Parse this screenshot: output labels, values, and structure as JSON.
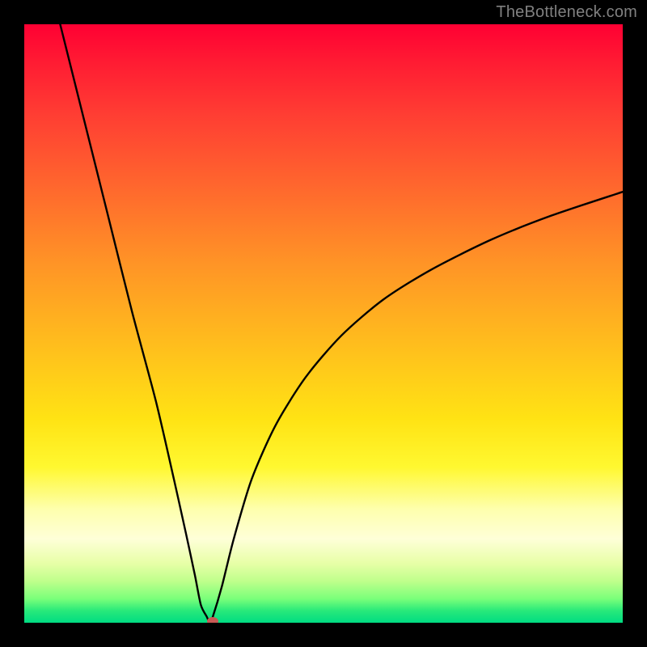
{
  "watermark": "TheBottleneck.com",
  "chart_data": {
    "type": "line",
    "title": "",
    "xlabel": "",
    "ylabel": "",
    "xlim": [
      0,
      100
    ],
    "ylim": [
      0,
      100
    ],
    "notes": "V-shaped bottleneck curve on a red-to-green vertical gradient background. Minimum of the curve sits at approximately x≈31, y≈0. Left arm rises steeply to y≈100 near x≈6. Right arm rises with a tapering logarithmic-like shape toward y≈72 at x=100.",
    "x": [
      6,
      10,
      14,
      18,
      22,
      25,
      27,
      28.5,
      29.5,
      30.5,
      31,
      31.5,
      33,
      35,
      38,
      42,
      47,
      53,
      60,
      68,
      78,
      88,
      100
    ],
    "values": [
      100,
      84,
      68,
      52,
      37,
      24,
      15,
      8,
      3,
      1,
      0,
      1,
      6,
      14,
      24,
      33,
      41,
      48,
      54,
      59,
      64,
      68,
      72
    ],
    "marker": {
      "x": 31.5,
      "y": 0,
      "color": "#c95a55"
    },
    "gradient_stops": [
      {
        "pos": 0,
        "color": "#ff0033"
      },
      {
        "pos": 50,
        "color": "#ffc21c"
      },
      {
        "pos": 80,
        "color": "#feffad"
      },
      {
        "pos": 100,
        "color": "#00dc82"
      }
    ]
  }
}
